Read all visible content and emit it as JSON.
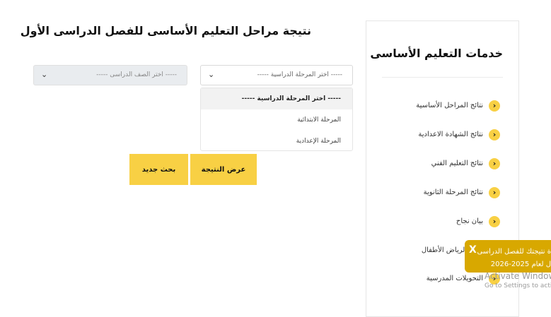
{
  "page": {
    "title": "نتيجة مراحل التعليم الأساسى للفصل الدراسى الأول"
  },
  "form": {
    "stage_select": {
      "value": "----- اختر المرحلة الدراسية -----"
    },
    "grade_select": {
      "value": "----- اختر الصف الدراسى -----"
    },
    "dropdown_options": [
      "----- اختر المرحلة الدراسية -----",
      "المرحلة الابتدائية",
      "المرحلة الإعدادية"
    ],
    "show_result_label": "عرض النتيجة",
    "new_search_label": "بحث جديد"
  },
  "sidebar": {
    "title": "خدمات التعليم الأساسى",
    "items": [
      {
        "label": "نتائج المراحل الأساسية"
      },
      {
        "label": "نتائج الشهادة الاعدادية"
      },
      {
        "label": "نتائج التعليم الفني"
      },
      {
        "label": "نتائج المرحلة الثانوية"
      },
      {
        "label": "بيان نجاح"
      },
      {
        "label": "تقديم لرياض الأطفال"
      },
      {
        "label": "التحويلات المدرسية"
      }
    ]
  },
  "toast": {
    "line1": "ة نتيجتك للفصل الدراسى",
    "line2": "ل لعام 2025-2026",
    "close_glyph": "X"
  },
  "watermark": {
    "line1": "Activate Windows",
    "line2": "Go to Settings to activat"
  },
  "colors": {
    "accent": "#f8d044",
    "toast": "#d8a800"
  }
}
